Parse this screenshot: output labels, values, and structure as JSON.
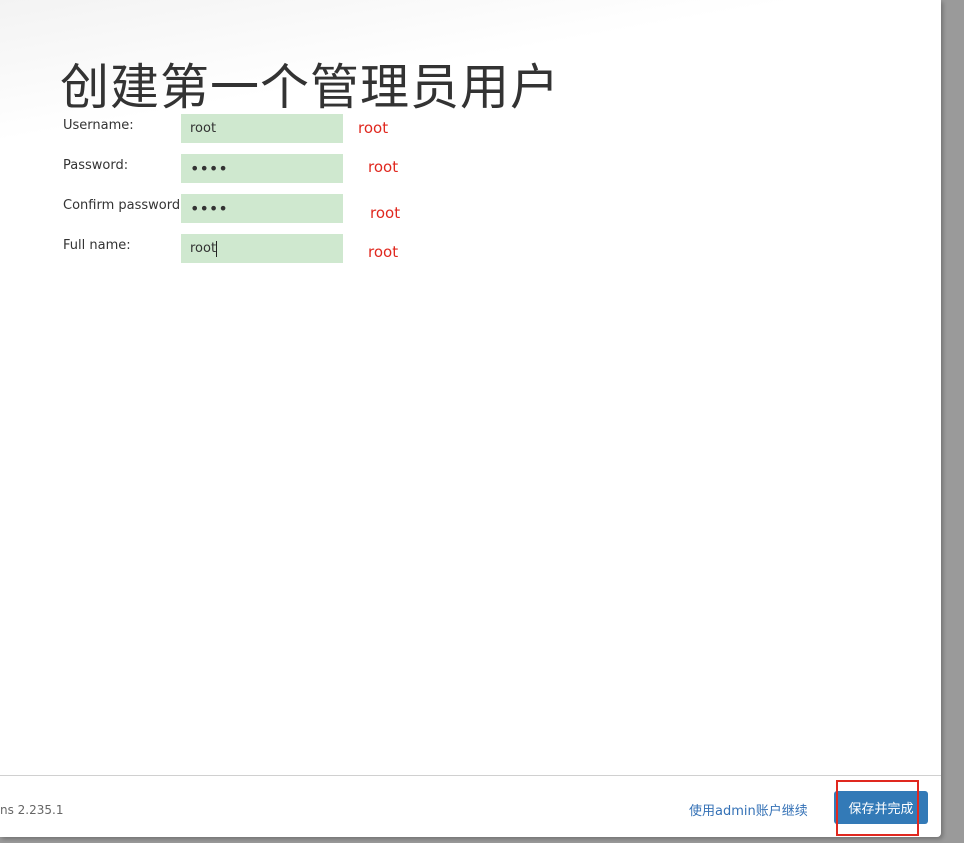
{
  "page": {
    "title": "创建第一个管理员用户"
  },
  "form": {
    "fields": [
      {
        "label": "Username:",
        "value": "root",
        "type": "text",
        "annotation": "root"
      },
      {
        "label": "Password:",
        "value": "••••",
        "type": "password",
        "annotation": "root"
      },
      {
        "label": "Confirm password:",
        "value": "••••",
        "type": "password",
        "annotation": "root"
      },
      {
        "label": "Full name:",
        "value": "root",
        "type": "text",
        "annotation": "root"
      }
    ]
  },
  "footer": {
    "version": "ns 2.235.1",
    "skip_label": "使用admin账户继续",
    "save_label": "保存并完成"
  },
  "colors": {
    "input_bg": "#cfe8cf",
    "annotation": "#e0281f",
    "primary": "#337ab7",
    "link": "#3471b6"
  }
}
